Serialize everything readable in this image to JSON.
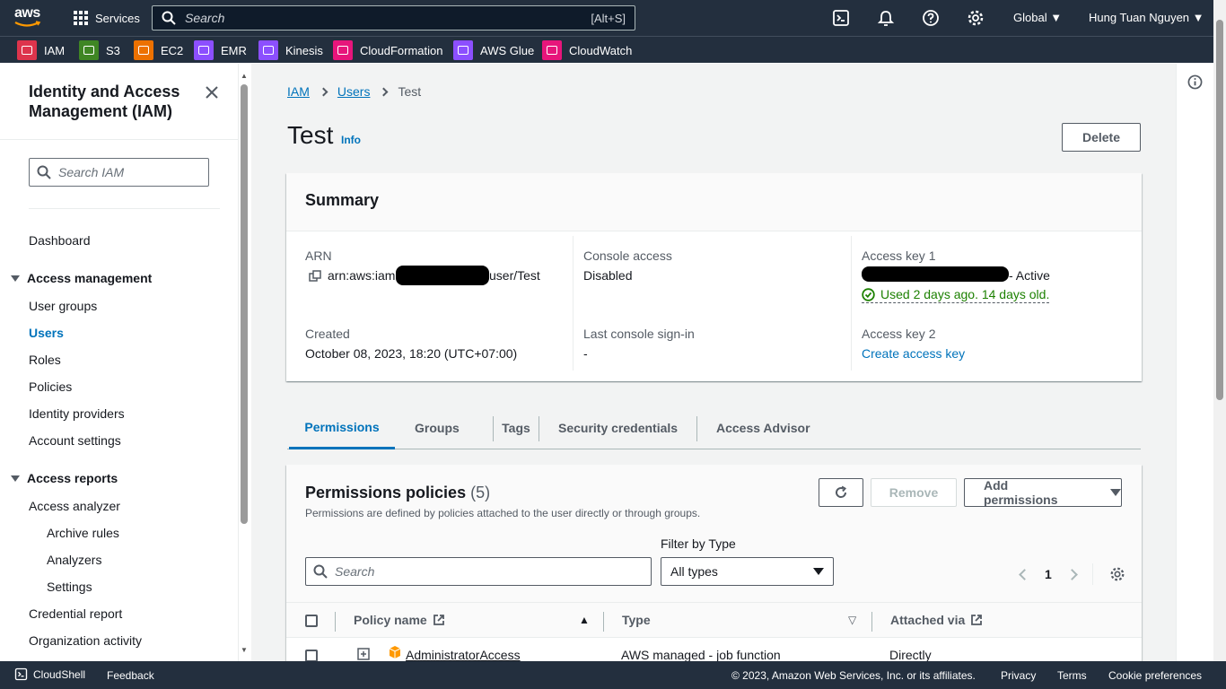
{
  "topnav": {
    "logo_text": "aws",
    "services_label": "Services",
    "search_placeholder": "Search",
    "search_shortcut": "[Alt+S]",
    "region": "Global",
    "user": "Hung Tuan Nguyen"
  },
  "favorites": [
    {
      "label": "IAM",
      "color": "#dd344c"
    },
    {
      "label": "S3",
      "color": "#3f8624"
    },
    {
      "label": "EC2",
      "color": "#ed7100"
    },
    {
      "label": "EMR",
      "color": "#8c4fff"
    },
    {
      "label": "Kinesis",
      "color": "#8c4fff"
    },
    {
      "label": "CloudFormation",
      "color": "#e7157b"
    },
    {
      "label": "AWS Glue",
      "color": "#8c4fff"
    },
    {
      "label": "CloudWatch",
      "color": "#e7157b"
    }
  ],
  "sidebar": {
    "title": "Identity and Access Management (IAM)",
    "search_placeholder": "Search IAM",
    "dashboard": "Dashboard",
    "access_management": "Access management",
    "user_groups": "User groups",
    "users": "Users",
    "roles": "Roles",
    "policies": "Policies",
    "identity_providers": "Identity providers",
    "account_settings": "Account settings",
    "access_reports": "Access reports",
    "access_analyzer": "Access analyzer",
    "archive_rules": "Archive rules",
    "analyzers": "Analyzers",
    "settings": "Settings",
    "credential_report": "Credential report",
    "organization_activity": "Organization activity"
  },
  "breadcrumb": {
    "iam": "IAM",
    "users": "Users",
    "current": "Test"
  },
  "page": {
    "title": "Test",
    "info": "Info",
    "delete_label": "Delete"
  },
  "summary": {
    "heading": "Summary",
    "arn_label": "ARN",
    "arn_prefix": "arn:aws:iam:",
    "arn_suffix": "user/Test",
    "created_label": "Created",
    "created_value": "October 08, 2023, 18:20 (UTC+07:00)",
    "console_access_label": "Console access",
    "console_access_value": "Disabled",
    "last_signin_label": "Last console sign-in",
    "last_signin_value": "-",
    "access_key1_label": "Access key 1",
    "access_key1_status": "- Active",
    "access_key1_usage": "Used 2 days ago. 14 days old.",
    "access_key2_label": "Access key 2",
    "create_access_key": "Create access key"
  },
  "tabs": [
    "Permissions",
    "Groups",
    "Tags",
    "Security credentials",
    "Access Advisor"
  ],
  "permissions": {
    "title": "Permissions policies",
    "count": "(5)",
    "description": "Permissions are defined by policies attached to the user directly or through groups.",
    "remove_label": "Remove",
    "add_label": "Add permissions",
    "filter_label": "Filter by Type",
    "search_placeholder": "Search",
    "filter_value": "All types",
    "page_number": "1",
    "columns": {
      "policy_name": "Policy name",
      "type": "Type",
      "attached_via": "Attached via"
    },
    "rows": [
      {
        "name": "AdministratorAccess",
        "type": "AWS managed - job function",
        "attached": "Directly"
      }
    ]
  },
  "footer": {
    "cloudshell": "CloudShell",
    "feedback": "Feedback",
    "copyright": "© 2023, Amazon Web Services, Inc. or its affiliates.",
    "privacy": "Privacy",
    "terms": "Terms",
    "cookie": "Cookie preferences"
  }
}
